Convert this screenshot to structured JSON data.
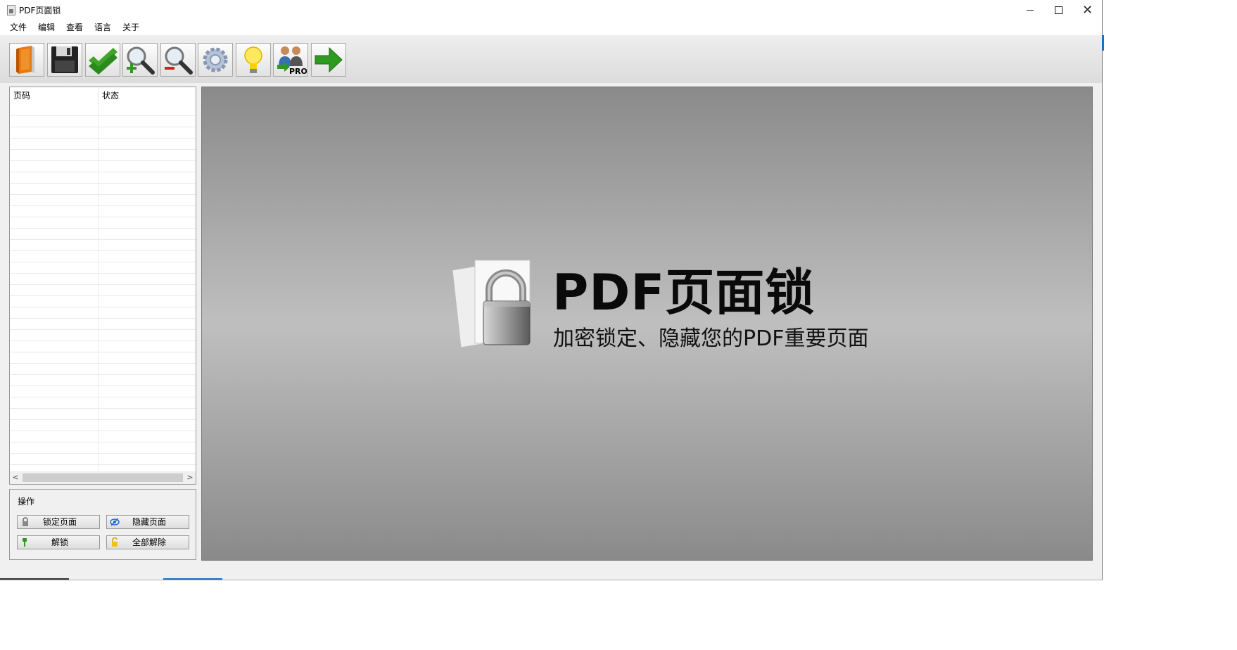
{
  "window": {
    "title": "PDF页面锁"
  },
  "menu": {
    "items": [
      "文件",
      "编辑",
      "查看",
      "语言",
      "关于"
    ]
  },
  "toolbar": {
    "buttons": [
      {
        "icon": "open-book-icon"
      },
      {
        "icon": "save-disk-icon"
      },
      {
        "icon": "double-check-icon"
      },
      {
        "icon": "zoom-in-icon"
      },
      {
        "icon": "zoom-out-icon"
      },
      {
        "icon": "settings-gear-icon"
      },
      {
        "icon": "lightbulb-icon"
      },
      {
        "icon": "pro-upgrade-icon",
        "label": "PRO"
      },
      {
        "icon": "exit-arrow-icon"
      }
    ]
  },
  "list": {
    "columns": [
      "页码",
      "状态"
    ]
  },
  "ops": {
    "title": "操作",
    "lock_label": "锁定页面",
    "hide_label": "隐藏页面",
    "unlock_label": "解锁",
    "unlock_all_label": "全部解除"
  },
  "preview": {
    "title": "PDF页面锁",
    "subtitle": "加密锁定、隐藏您的PDF重要页面"
  },
  "colors": {
    "accent": "#1a6fc9",
    "arrow_green": "#2e9a1f"
  }
}
